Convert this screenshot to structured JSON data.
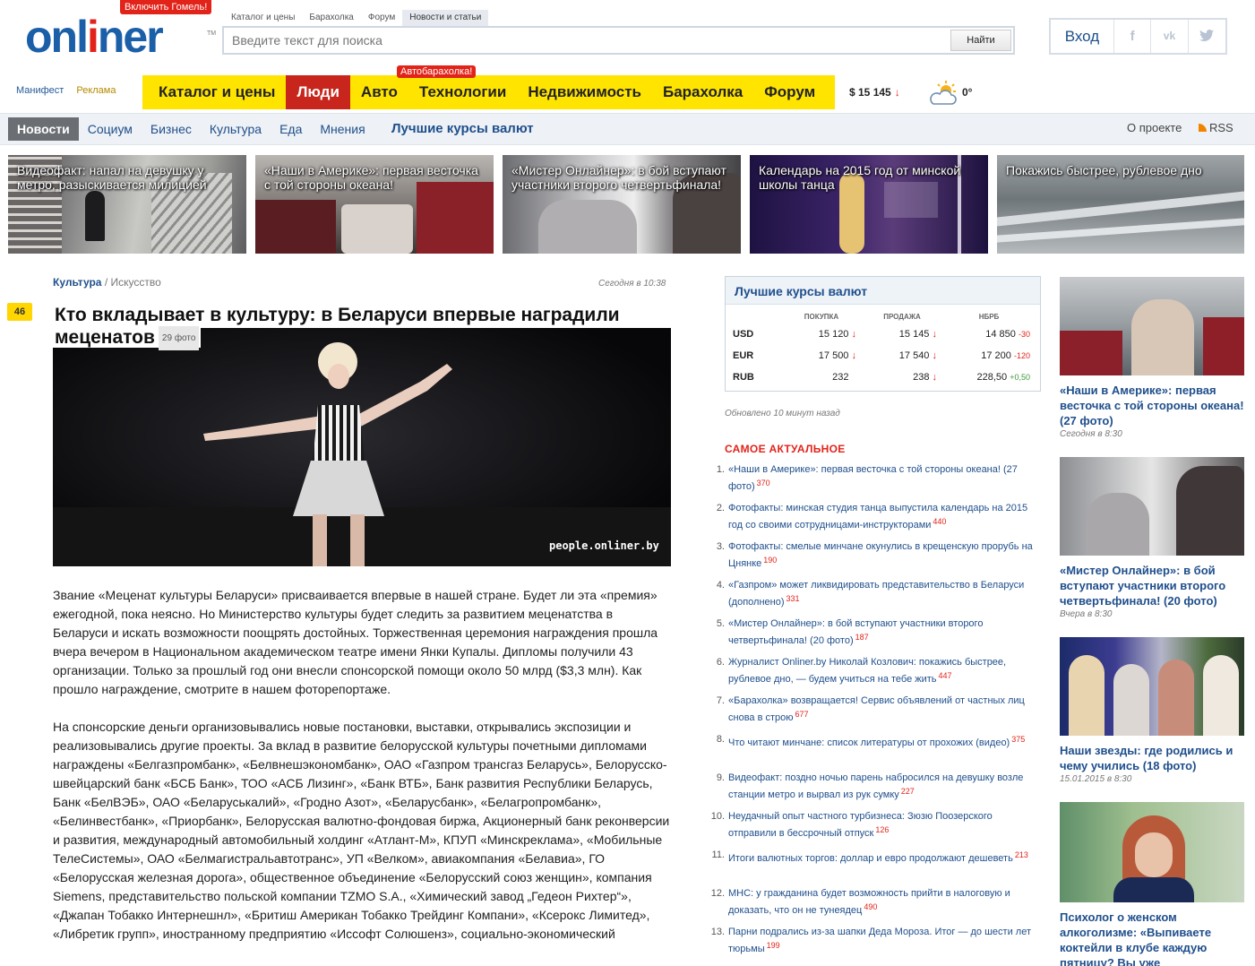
{
  "header": {
    "logo_text_a": "onl",
    "logo_text_b": "i",
    "logo_text_c": "ner",
    "logo_tm": "TM",
    "gomel_badge": "Включить Гомель!",
    "search_tabs": [
      "Каталог и цены",
      "Барахолка",
      "Форум",
      "Новости и статьи"
    ],
    "search_placeholder": "Введите текст для поиска",
    "search_button": "Найти",
    "login_label": "Вход",
    "social": [
      "f",
      "vk",
      "tw"
    ]
  },
  "subleft": [
    "Манифест",
    "Реклама"
  ],
  "mainnav": {
    "items": [
      "Каталог и цены",
      "Люди",
      "Авто",
      "Технологии",
      "Недвижимость",
      "Барахолка",
      "Форум"
    ],
    "active": "Люди",
    "avto_badge": "Автобарахолка!"
  },
  "rate": {
    "value": "$ 15 145",
    "arrow": "↓"
  },
  "weather": {
    "icon": "cloudy-sun-icon",
    "temp": "0°"
  },
  "newsnav": {
    "tabs": [
      "Новости",
      "Социум",
      "Бизнес",
      "Культура",
      "Еда",
      "Мнения"
    ],
    "active": "Новости",
    "best": "Лучшие курсы валют",
    "about": "О проекте",
    "rss": "RSS"
  },
  "tiles": [
    "Видеофакт: напал на девушку у метро, разыскивается милицией",
    "«Наши в Америке»: первая весточка с той стороны океана!",
    "«Мистер Онлайнер»: в бой вступают участники второго четвертьфинала!",
    "Календарь на 2015 год от минской школы танца",
    "Покажись быстрее, рублевое дно"
  ],
  "article": {
    "crumb_section": "Культура",
    "crumb_sep": " / ",
    "crumb_sub": "Искусство",
    "date": "Сегодня в 10:38",
    "comments": "46",
    "title_line1": "Кто вкладывает в культуру: в Беларуси впервые наградили",
    "title_line2": "меценатов",
    "photos": "29 фото",
    "watermark": "people.onliner.by",
    "para1": "Звание «Меценат культуры Беларуси» присваивается впервые в нашей стране. Будет ли эта «премия» ежегодной, пока неясно. Но Министерство культуры будет следить за развитием меценатства в Беларуси и искать возможности поощрять достойных. Торжественная церемония награждения прошла вчера вечером в Национальном академическом театре имени Янки Купалы. Дипломы получили 43 организации. Только за прошлый год они внесли спонсорской помощи около 50 млрд ($3,3 млн). Как прошло награждение, смотрите в нашем фоторепортаже.",
    "para2": "На спонсорские деньги организовывались новые постановки, выставки, открывались экспозиции и реализовывались другие проекты. За вклад в развитие белорусской культуры почетными дипломами награждены «Белгазпромбанк», «Белвнешэкономбанк», ОАО «Газпром трансгаз Беларусь», Белорусско-швейцарский банк «БСБ Банк», ТОО «АСБ Лизинг», «Банк ВТБ», Банк развития Республики Беларусь, Банк «БелВЭБ», ОАО «Беларуськалий», «Гродно Азот», «Беларусбанк», «Белагропромбанк», «Белинвестбанк», «Приорбанк», Белорусская валютно-фондовая биржа, Акционерный банк реконверсии и развития, международный автомобильный холдинг «Атлант-М», КПУП «Минскреклама», «Мобильные ТелеСистемы», ОАО «Белмагистральавтотранс», УП «Велком», авиакомпания «Белавиа», ГО «Белорусская железная дорога», общественное объединение «Белорусский союз женщин», компания Siemens, представительство польской компании TZMO S.A., «Химический завод „Гедеон Рихтер“», «Джапан Тобакко Интернешнл», «Бритиш Американ Тобакко Трейдинг Компани», «Ксерокс Лимитед», «Либретик групп», иностранному предприятию «Иссофт Солюшенз», социально-экономический"
  },
  "currency": {
    "title": "Лучшие курсы валют",
    "headers": [
      "",
      "ПОКУПКА",
      "ПРОДАЖА",
      "НБРБ"
    ],
    "rows": [
      {
        "code": "USD",
        "buy": "15 120",
        "sell": "15 145",
        "nbrb": "14 850",
        "chg": "-30",
        "up": false
      },
      {
        "code": "EUR",
        "buy": "17 500",
        "sell": "17 540",
        "nbrb": "17 200",
        "chg": "-120",
        "up": false
      },
      {
        "code": "RUB",
        "buy": "232",
        "sell": "238",
        "nbrb": "228,50",
        "chg": "+0,50",
        "up": true
      }
    ],
    "buy_arrow": [
      true,
      true,
      false
    ],
    "updated": "Обновлено 10 минут назад"
  },
  "actual": {
    "title": "САМОЕ АКТУАЛЬНОЕ",
    "items": [
      {
        "n": "1.",
        "text": "«Наши в Америке»: первая весточка с той стороны океана! (27 фото)",
        "cnt": "370"
      },
      {
        "n": "2.",
        "text": "Фотофакты: минская студия танца выпустила календарь на 2015 год со своими сотрудницами-инструкторами",
        "cnt": "440"
      },
      {
        "n": "3.",
        "text": "Фотофакты: смелые минчане окунулись в крещенскую прорубь на Цнянке",
        "cnt": "190"
      },
      {
        "n": "4.",
        "text": "«Газпром» может ликвидировать представительство в Беларуси (дополнено)",
        "cnt": "331"
      },
      {
        "n": "5.",
        "text": "«Мистер Онлайнер»: в бой вступают участники второго четвертьфинала! (20 фото)",
        "cnt": "187"
      },
      {
        "n": "6.",
        "text": "Журналист Onliner.by Николай Козлович: покажись быстрее, рублевое дно, — будем учиться на тебе жить",
        "cnt": "447"
      },
      {
        "n": "7.",
        "text": "«Барахолка» возвращается! Сервис объявлений от частных лиц снова в строю",
        "cnt": "677"
      },
      {
        "n": "8.",
        "text": "Что читают минчане: список литературы от прохожих (видео)",
        "cnt": "375"
      },
      {
        "n": "9.",
        "text": "Видеофакт: поздно ночью парень набросился на девушку возле станции метро и вырвал из рук сумку",
        "cnt": "227"
      },
      {
        "n": "10.",
        "text": "Неудачный опыт частного турбизнеса: Зюзю Поозерского отправили в бессрочный отпуск",
        "cnt": "126"
      },
      {
        "n": "11.",
        "text": "Итоги валютных торгов: доллар и евро продолжают дешеветь",
        "cnt": "213"
      },
      {
        "n": "12.",
        "text": "МНС: у гражданина будет возможность прийти в налоговую и доказать, что он не тунеядец",
        "cnt": "490"
      },
      {
        "n": "13.",
        "text": "Парни подрались из-за шапки Деда Мороза. Итог — до шести лет тюрьмы",
        "cnt": "199"
      }
    ]
  },
  "rightcol": [
    {
      "title": "«Наши в Америке»: первая весточка с той стороны океана! (27 фото)",
      "date": "Сегодня в 8:30"
    },
    {
      "title": "«Мистер Онлайнер»: в бой вступают участники второго четвертьфинала! (20 фото)",
      "date": "Вчера в 8:30"
    },
    {
      "title": "Наши звезды: где родились и чему учились (18 фото)",
      "date": "15.01.2015 в 8:30"
    },
    {
      "title": "Психолог о женском алкоголизме: «Выпиваете коктейли в клубе каждую пятницу? Вы уже",
      "date": ""
    }
  ]
}
